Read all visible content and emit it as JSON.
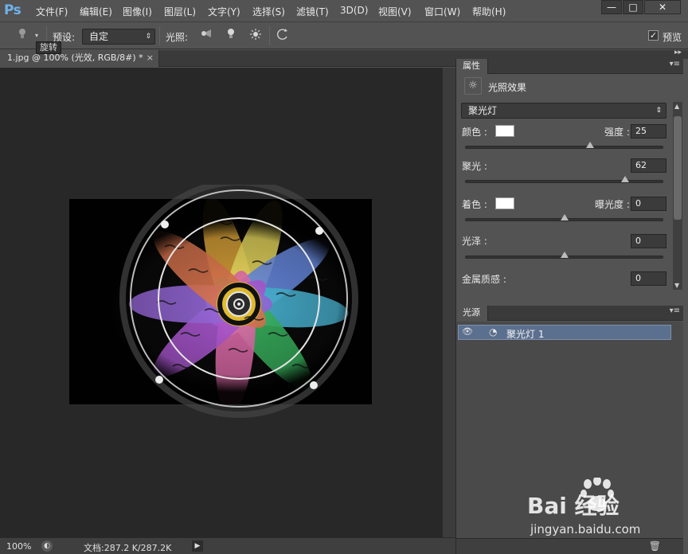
{
  "app": {
    "logo": "Ps"
  },
  "menu": {
    "items": [
      "文件(F)",
      "编辑(E)",
      "图像(I)",
      "图层(L)",
      "文字(Y)",
      "选择(S)",
      "滤镜(T)",
      "3D(D)",
      "视图(V)",
      "窗口(W)",
      "帮助(H)"
    ]
  },
  "window_controls": {
    "minimize": "—",
    "maximize": "□",
    "close": "✕"
  },
  "options": {
    "preset_label": "预设:",
    "preset_value": "自定",
    "lights_label": "光照:",
    "preview_label": "预览",
    "preview_checked": "✓",
    "tooltip": "旋转"
  },
  "document": {
    "tab_title": "1.jpg @ 100% (光效, RGB/8#) *",
    "tab_close": "×"
  },
  "status": {
    "zoom": "100%",
    "doc_info": "文档:287.2 K/287.2K"
  },
  "properties": {
    "tab_label": "属性",
    "title": "光照效果",
    "light_type": "聚光灯",
    "color_label": "颜色 :",
    "intensity_label": "强度 :",
    "intensity_value": "25",
    "intensity_slider": 0.63,
    "hotspot_label": "聚光 :",
    "hotspot_value": "62",
    "hotspot_slider": 0.81,
    "colorize_label": "着色 :",
    "exposure_label": "曝光度 :",
    "exposure_value": "0",
    "exposure_slider": 0.5,
    "gloss_label": "光泽 :",
    "gloss_value": "0",
    "gloss_slider": 0.5,
    "metallic_label": "金属质感 :",
    "metallic_value": "0",
    "color_swatch": "#ffffff",
    "colorize_swatch": "#ffffff"
  },
  "lights_panel": {
    "tab_label": "光源",
    "items": [
      {
        "label": "聚光灯 1"
      }
    ]
  },
  "watermark": {
    "brand": "Bai  经验",
    "url": "jingyan.baidu.com"
  },
  "colors": {
    "accent": "#6fb2ec",
    "selection": "#5b6f8e",
    "canvas_bg": "#282828"
  }
}
